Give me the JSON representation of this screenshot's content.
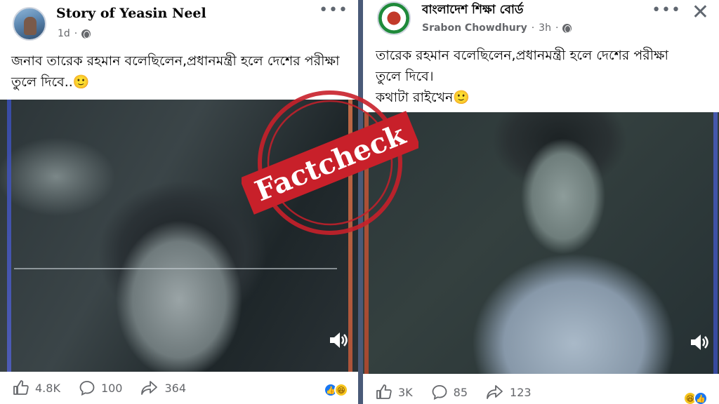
{
  "posts": [
    {
      "page_name": "Story of Yeasin Neel",
      "time": "1d",
      "caption": "জনাব তারেক রহমান বলেছিলেন,প্রধানমন্ত্রী হলে দেশের পরীক্ষা তুলে দিবে..🙂",
      "likes": "4.8K",
      "comments": "100",
      "shares": "364",
      "reactions": [
        "like",
        "haha"
      ]
    },
    {
      "page_name": "বাংলাদেশ শিক্ষা বোর্ড",
      "author": "Srabon Chowdhury",
      "time": "3h",
      "caption": "তারেক রহমান বলেছিলেন,প্রধানমন্ত্রী হলে দেশের পরীক্ষা\nতুলে দিবে।\nকথাটা রাইখেন🙂",
      "likes": "3K",
      "comments": "85",
      "shares": "123",
      "reactions": [
        "haha",
        "like"
      ]
    }
  ],
  "stamp": {
    "text": "Factcheck",
    "color": "#c8202a"
  },
  "colors": {
    "background": "#4a5a78",
    "accent": "#1877f2",
    "muted": "#65676b"
  }
}
